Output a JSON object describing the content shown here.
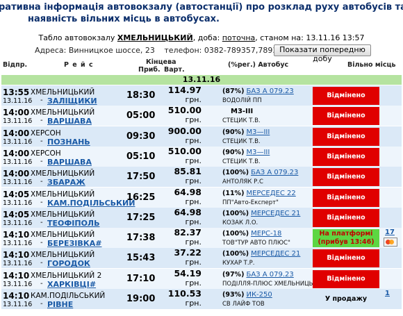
{
  "header": {
    "line1": "ративна інформація автовокзалу (автостанції) про розклад руху автобусів та його зміни,",
    "line2": "наявність вільних місць в автобусах."
  },
  "tablo": {
    "prefix": "Табло автовокзалу",
    "station": "ХМЕЛЬНИЦЬКИЙ",
    "sep": ", доба:",
    "day": "поточна",
    "state": ", станом на:",
    "datetime": "13.11.16 13:57",
    "address": "Адреса: Винницкое шоссе, 23",
    "phone": "телефон: 0382-789357,789355",
    "prev_button": "Показати попередню добу"
  },
  "columns": {
    "depart": "Відпр.",
    "route": "Р е й с",
    "final": "Кінцева",
    "arrive": "Приб.",
    "price": "Варт.",
    "bus": "(%рег.) Автобус",
    "seats": "Вільно місць"
  },
  "date_band": "13.11.16",
  "rows": [
    {
      "time": "13:55",
      "from": "ХМЕЛЬНИЦЬКИЙ",
      "date": "13.11.16",
      "dest": "ЗАЛІЩИКИ",
      "arr": "18:30",
      "price": "114.97",
      "unit": "грн.",
      "pct": "(87%)",
      "bus": "БАЗ А 079.23",
      "bus_link": true,
      "carrier": "ВОДОЛІЙ ПП",
      "status": "Відмінено",
      "status_type": "red",
      "seats": ""
    },
    {
      "time": "14:00",
      "from": "ХМЕЛЬНИЦЬКИЙ",
      "date": "13.11.16",
      "dest": "ВАРШАВА",
      "arr": "05:00",
      "price": "510.00",
      "unit": "грн.",
      "pct": "",
      "bus": "М3-III",
      "bus_link": false,
      "carrier": "СТЕЦИК Т.В.",
      "status": "Відмінено",
      "status_type": "red",
      "seats": ""
    },
    {
      "time": "14:00",
      "from": "ХЕРСОН",
      "date": "13.11.16",
      "dest": "ПОЗНАНЬ",
      "arr": "09:30",
      "price": "900.00",
      "unit": "грн.",
      "pct": "(90%)",
      "bus": "М3—III",
      "bus_link": true,
      "carrier": "СТЕЦИК Т.В.",
      "status": "Відмінено",
      "status_type": "red",
      "seats": ""
    },
    {
      "time": "14:00",
      "from": "ХЕРСОН",
      "date": "13.11.16",
      "dest": "ВАРШАВА",
      "arr": "05:10",
      "price": "510.00",
      "unit": "грн.",
      "pct": "(90%)",
      "bus": "М3—III",
      "bus_link": true,
      "carrier": "СТЕЦИК Т.В.",
      "status": "Відмінено",
      "status_type": "red",
      "seats": ""
    },
    {
      "time": "14:00",
      "from": "ХМЕЛЬНИЦЬКИЙ",
      "date": "13.11.16",
      "dest": "ЗБАРАЖ",
      "arr": "17:50",
      "price": "85.81",
      "unit": "грн.",
      "pct": "(100%)",
      "bus": "БАЗ А 079.23",
      "bus_link": true,
      "carrier": "АНТОЛЯК Р.С",
      "status": "Відмінено",
      "status_type": "red",
      "seats": ""
    },
    {
      "time": "14:05",
      "from": "ХМЕЛЬНИЦЬКИЙ",
      "date": "13.11.16",
      "dest": "КАМ.ПОДІЛЬСЬКИЙ",
      "arr": "16:25",
      "price": "64.98",
      "unit": "грн.",
      "pct": "(11%)",
      "bus": "МЕРСЕДЕС 22",
      "bus_link": true,
      "carrier": "ПП\"Авто-Експерт\"",
      "status": "Відмінено",
      "status_type": "red",
      "seats": ""
    },
    {
      "time": "14:05",
      "from": "ХМЕЛЬНИЦЬКИЙ",
      "date": "13.11.16",
      "dest": "ТЕОФІПОЛЬ",
      "arr": "17:25",
      "price": "64.98",
      "unit": "грн.",
      "pct": "(100%)",
      "bus": "МЕРСЕДЕС 21",
      "bus_link": true,
      "carrier": "КОЗАК Л.О.",
      "status": "Відмінено",
      "status_type": "red",
      "seats": ""
    },
    {
      "time": "14:10",
      "from": "ХМЕЛЬНИЦЬКИЙ",
      "date": "13.11.16",
      "dest": "БЕРЕЗІВКА#",
      "arr": "17:38",
      "price": "82.37",
      "unit": "грн.",
      "pct": "(100%)",
      "bus": "МЕРС-18",
      "bus_link": true,
      "carrier": "ТОВ\"ТУР АВТО ПЛЮС\"",
      "status": "На платформі",
      "status_sub": "(прибув 13:46)",
      "status_type": "green",
      "seats": "17"
    },
    {
      "time": "14:10",
      "from": "ХМЕЛЬНИЦЬКИЙ",
      "date": "13.11.16",
      "dest": "ГОРОДОК",
      "arr": "15:43",
      "price": "37.22",
      "unit": "грн.",
      "pct": "(100%)",
      "bus": "МЕРСЕДЕС 21",
      "bus_link": true,
      "carrier": "КУХАР Т.Р.",
      "status": "Відмінено",
      "status_type": "red",
      "seats": ""
    },
    {
      "time": "14:10",
      "from": "ХМЕЛЬНИЦЬКИЙ 2",
      "date": "13.11.16",
      "dest": "ХАРКІВЦІ#",
      "arr": "17:10",
      "price": "54.19",
      "unit": "грн.",
      "pct": "(97%)",
      "bus": "БАЗ А 079.23",
      "bus_link": true,
      "carrier": "ПОДІЛЛЯ-ПЛЮС ХМЕЛЬНИЦЬКИЙ ВАТ",
      "status": "Відмінено",
      "status_type": "red",
      "seats": ""
    },
    {
      "time": "14:10",
      "from": "КАМ.ПОДІЛЬСЬКИЙ",
      "date": "13.11.16",
      "dest": "РІВНЕ",
      "arr": "19:00",
      "price": "110.53",
      "unit": "грн.",
      "pct": "(93%)",
      "bus": "ИК-250",
      "bus_link": true,
      "carrier": "СВ ЛАЙФ ТОВ",
      "status": "У продажу",
      "status_type": "white",
      "seats": "1"
    }
  ]
}
